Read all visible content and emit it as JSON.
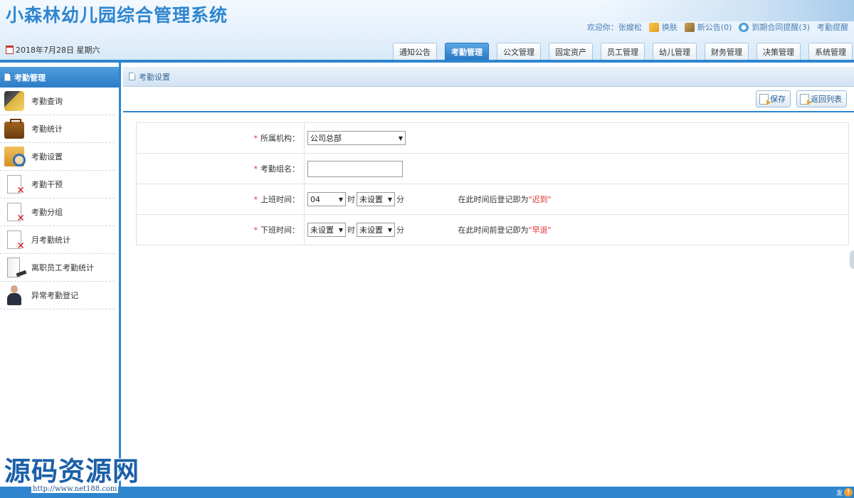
{
  "header": {
    "title": "小森林幼儿园综合管理系统",
    "user_bar": {
      "welcome": "欢迎你：张嫂松",
      "skin_label": "换肤",
      "notice_label": "新公告(0)",
      "contract_label": "到期合同提醒(3)",
      "attendance_alert_label": "考勤提醒"
    },
    "date": "2018年7月28日 星期六",
    "nav_tabs": [
      {
        "label": "通知公告",
        "active": false
      },
      {
        "label": "考勤管理",
        "active": true
      },
      {
        "label": "公文管理",
        "active": false
      },
      {
        "label": "固定资产",
        "active": false
      },
      {
        "label": "员工管理",
        "active": false
      },
      {
        "label": "幼儿管理",
        "active": false
      },
      {
        "label": "财务管理",
        "active": false
      },
      {
        "label": "决策管理",
        "active": false
      },
      {
        "label": "系统管理",
        "active": false
      }
    ]
  },
  "sidebar": {
    "title": "考勤管理",
    "items": [
      {
        "label": "考勤查询",
        "icon": "query-icon"
      },
      {
        "label": "考勤统计",
        "icon": "briefcase-icon"
      },
      {
        "label": "考勤设置",
        "icon": "settings-search-icon"
      },
      {
        "label": "考勤干预",
        "icon": "document-x-icon"
      },
      {
        "label": "考勤分组",
        "icon": "document-x-icon"
      },
      {
        "label": "月考勤统计",
        "icon": "document-x-icon"
      },
      {
        "label": "离职员工考勤统计",
        "icon": "resign-icon"
      },
      {
        "label": "异常考勤登记",
        "icon": "person-icon"
      }
    ]
  },
  "main": {
    "breadcrumb": "考勤设置",
    "toolbar": {
      "save_label": "保存",
      "back_label": "返回列表"
    },
    "form": {
      "org_label": "所属机构：",
      "org_value": "公司总部",
      "group_label": "考勤组名：",
      "group_value": "",
      "on_duty_label": "上班时间：",
      "on_hour_value": "04",
      "on_minute_value": "未设置",
      "on_hint_prefix": "在此时间后登记即为",
      "on_hint_emph": "\"迟到\"",
      "off_duty_label": "下班时间：",
      "off_hour_value": "未设置",
      "off_minute_value": "未设置",
      "off_hint_prefix": "在此时间前登记即为",
      "off_hint_emph": "\"早退\"",
      "hour_unit": "时",
      "minute_unit": "分",
      "required_mark": "*"
    }
  },
  "watermark": {
    "text": "源码资源网",
    "url": "http://www.net188.com"
  },
  "footer": {
    "info_badge": "!",
    "info_text": "发"
  },
  "colors": {
    "brand_blue": "#2f86cf",
    "required_red": "#e0332f",
    "title_blue": "#2f86cf"
  }
}
